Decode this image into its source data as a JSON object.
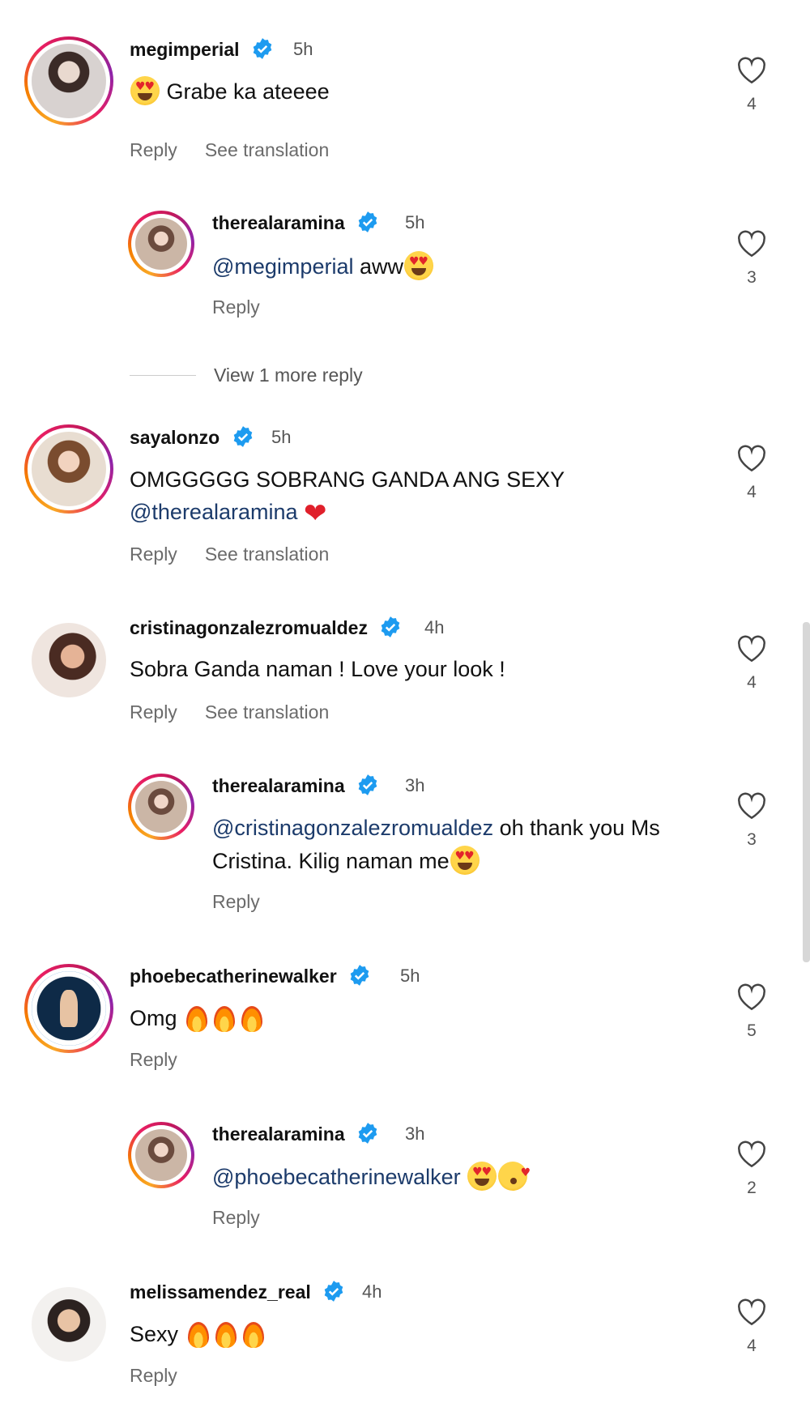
{
  "comments": [
    {
      "user": "megimperial",
      "time": "5h",
      "text": "Grabe ka ateeee",
      "likes": "4",
      "reply": "Reply",
      "translate": "See translation"
    },
    {
      "user": "therealaramina",
      "time": "5h",
      "mention": "@megimperial",
      "text": " aww",
      "likes": "3",
      "reply": "Reply"
    },
    {
      "view_more": "View 1 more reply"
    },
    {
      "user": "sayalonzo",
      "time": "5h",
      "text": "OMGGGGG SOBRANG GANDA ANG SEXY",
      "mention": "@therealaramina",
      "likes": "4",
      "reply": "Reply",
      "translate": "See translation"
    },
    {
      "user": "cristinagonzalezromualdez",
      "time": "4h",
      "text": "Sobra Ganda naman ! Love your look !",
      "likes": "4",
      "reply": "Reply",
      "translate": "See translation"
    },
    {
      "user": "therealaramina",
      "time": "3h",
      "mention": "@cristinagonzalezromualdez",
      "text": " oh thank you Ms",
      "text2": "Cristina. Kilig naman me",
      "likes": "3",
      "reply": "Reply"
    },
    {
      "user": "phoebecatherinewalker",
      "time": "5h",
      "text": "Omg",
      "likes": "5",
      "reply": "Reply"
    },
    {
      "user": "therealaramina",
      "time": "3h",
      "mention": "@phoebecatherinewalker",
      "likes": "2",
      "reply": "Reply"
    },
    {
      "user": "melissamendez_real",
      "time": "4h",
      "text": "Sexy",
      "likes": "4",
      "reply": "Reply"
    }
  ],
  "icons": {
    "verified": "verified-badge-icon",
    "like": "heart-outline-icon"
  },
  "colors": {
    "verified": "#1d9bf0",
    "mention": "#1c3b6b",
    "heart_emoji": "#e0202b"
  }
}
